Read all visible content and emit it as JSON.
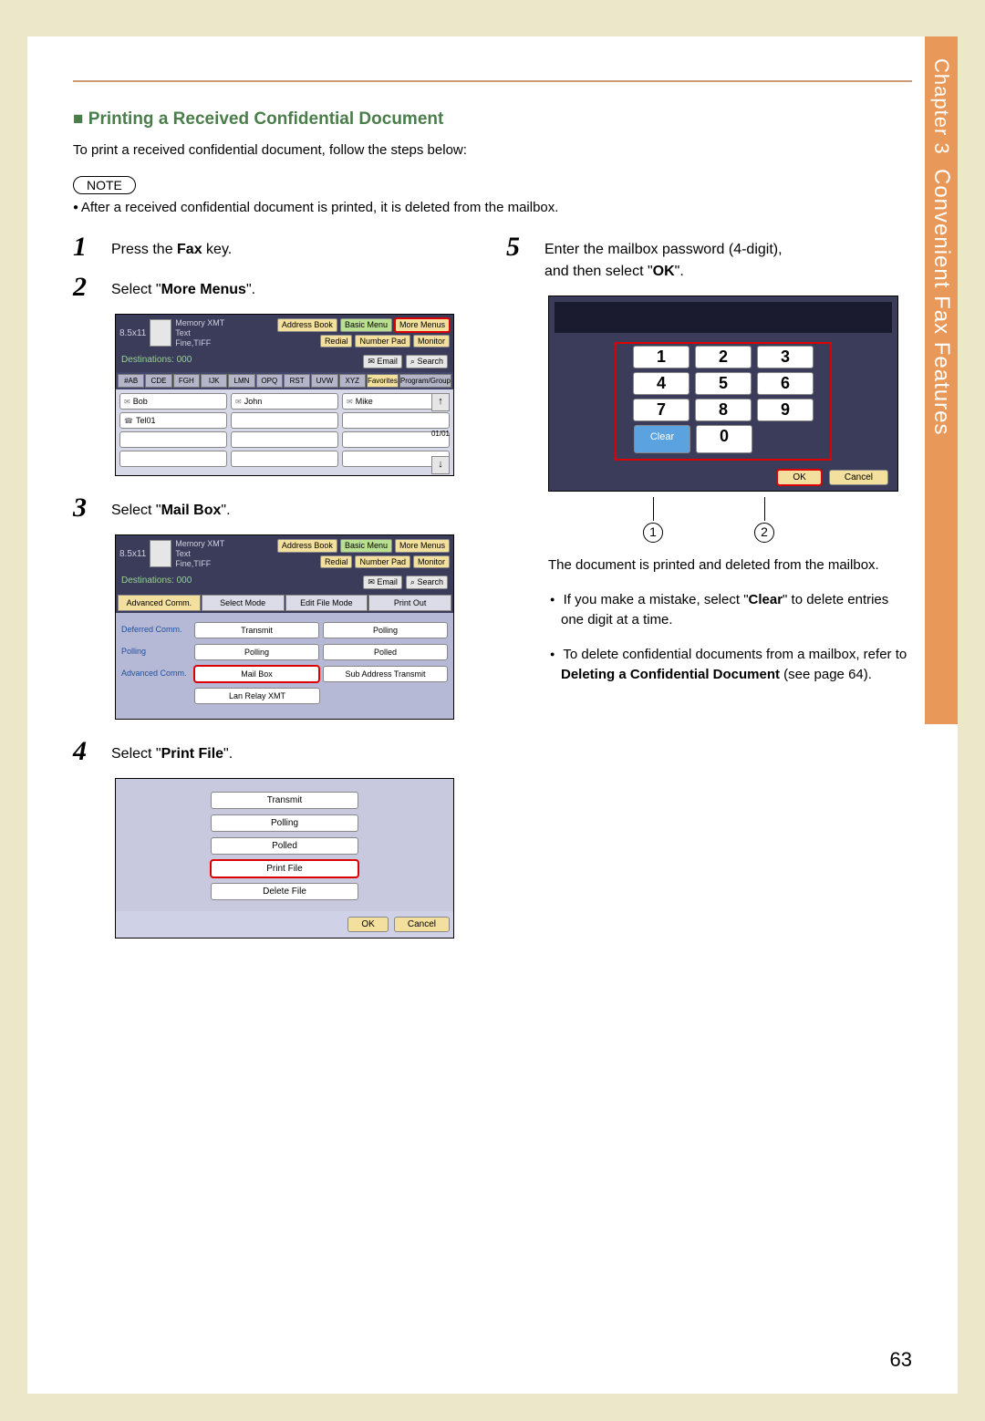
{
  "sideTab": {
    "chapter": "Chapter 3",
    "title": "Convenient Fax Features"
  },
  "pageNumber": "63",
  "section": {
    "bullet": "■",
    "title": "Printing a Received Confidential Document",
    "intro": "To print a received confidential document, follow the steps below:",
    "noteLabel": "NOTE",
    "noteText": "After a received confidential document is printed, it is deleted from the mailbox."
  },
  "steps": {
    "s1": {
      "num": "1",
      "pre": "Press the ",
      "bold": "Fax",
      "post": " key."
    },
    "s2": {
      "num": "2",
      "pre": "Select \"",
      "bold": "More Menus",
      "post": "\"."
    },
    "s3": {
      "num": "3",
      "pre": "Select \"",
      "bold": "Mail Box",
      "post": "\"."
    },
    "s4": {
      "num": "4",
      "pre": "Select \"",
      "bold": "Print File",
      "post": "\"."
    },
    "s5": {
      "num": "5",
      "line1": "Enter the mailbox password (4-digit),",
      "line2pre": "and then select \"",
      "line2bold": "OK",
      "line2post": "\"."
    }
  },
  "ss1": {
    "paper": "8.5x11",
    "mode": "Memory XMT",
    "textLabel": "Text",
    "res": "Fine,TIFF",
    "addressBook": "Address Book",
    "basicMenu": "Basic Menu",
    "moreMenus": "More Menus",
    "redial": "Redial",
    "numberPad": "Number Pad",
    "monitor": "Monitor",
    "dest": "Destinations: 000",
    "email": "Email",
    "search": "Search",
    "tabs": [
      "#AB",
      "CDE",
      "FGH",
      "IJK",
      "LMN",
      "OPQ",
      "RST",
      "UVW",
      "XYZ",
      "Favorites",
      "Program/Group"
    ],
    "contacts": [
      "Bob",
      "John",
      "Mike",
      "Tel01"
    ],
    "scrollCount": "01/01"
  },
  "ss2": {
    "tabs": [
      "Advanced Comm.",
      "Select Mode",
      "Edit File Mode",
      "Print Out"
    ],
    "rows": [
      {
        "label": "Deferred Comm.",
        "cells": [
          "Transmit",
          "Polling"
        ]
      },
      {
        "label": "Polling",
        "cells": [
          "Polling",
          "Polled"
        ]
      },
      {
        "label": "Advanced Comm.",
        "cells": [
          "Mail Box",
          "Sub Address Transmit"
        ]
      },
      {
        "label": "",
        "cells": [
          "Lan Relay XMT",
          ""
        ]
      }
    ],
    "mailboxHl": true
  },
  "ss3": {
    "buttons": [
      "Transmit",
      "Polling",
      "Polled",
      "Print File",
      "Delete File"
    ],
    "ok": "OK",
    "cancel": "Cancel"
  },
  "ss4": {
    "keys": [
      [
        "1",
        "2",
        "3"
      ],
      [
        "4",
        "5",
        "6"
      ],
      [
        "7",
        "8",
        "9"
      ],
      [
        "Clear",
        "0",
        ""
      ]
    ],
    "ok": "OK",
    "cancel": "Cancel"
  },
  "callouts": {
    "c1": "1",
    "c2": "2"
  },
  "after": {
    "printed": "The document is printed and deleted from the mailbox.",
    "b1a": "If you make a mistake, select \"",
    "b1bold": "Clear",
    "b1b": "\" to delete entries one digit at a time.",
    "b2a": "To delete confidential documents from a mailbox, refer to ",
    "b2bold": "Deleting a Confidential Document",
    "b2b": " (see page 64)."
  }
}
